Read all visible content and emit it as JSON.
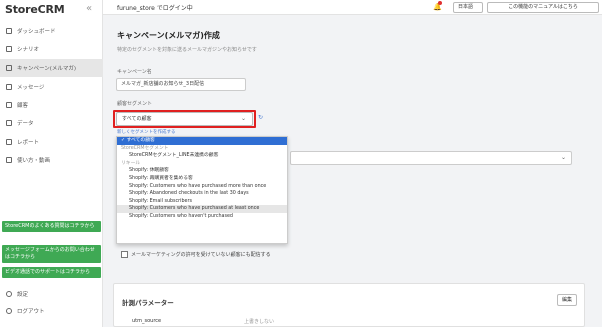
{
  "app": {
    "logo": "StoreCRM",
    "collapse": "«"
  },
  "sidebar": {
    "items": [
      {
        "label": "ダッシュボード"
      },
      {
        "label": "シナリオ"
      },
      {
        "label": "キャンペーン(メルマガ)"
      },
      {
        "label": "メッセージ"
      },
      {
        "label": "顧客"
      },
      {
        "label": "データ"
      },
      {
        "label": "レポート"
      },
      {
        "label": "使い方・動画"
      }
    ],
    "green_buttons": [
      {
        "label": "StoreCRMのよくある質問はコチラから"
      },
      {
        "label": "メッセージフォームからのお問い合わせはコチラから"
      },
      {
        "label": "ビデオ通話でのサポートはコチラから"
      }
    ],
    "bottom": [
      {
        "label": "設定"
      },
      {
        "label": "ログアウト"
      }
    ]
  },
  "topbar": {
    "store": "furune_store でログイン中",
    "bell": "🔔",
    "lang": "日本語",
    "manual": "この機能のマニュアルはこちら"
  },
  "page": {
    "title": "キャンペーン(メルマガ)作成",
    "subtitle": "特定のセグメントを対象に送るメールマガジンやお知らせです"
  },
  "form": {
    "name_label": "キャンペーン名",
    "name_value": "メルマガ_新店舗のお知らせ_3日配信",
    "segment_label": "顧客セグメント",
    "segment_value": "すべての顧客",
    "segment_link": "新しくセグメントを作成する",
    "refresh_icon": "refresh-icon"
  },
  "dropdown": {
    "options": [
      {
        "label": "✓ すべての顧客",
        "kind": "selected"
      },
      {
        "label": "StoreCRMセグメント",
        "kind": "group"
      },
      {
        "label": "StoreCRMセグメント_LINE未連携の顧客",
        "kind": "item"
      },
      {
        "label": "リキール",
        "kind": "group"
      },
      {
        "label": "Shopify: 休眠顧客",
        "kind": "item"
      },
      {
        "label": "Shopify: 再購買者を集める客",
        "kind": "item"
      },
      {
        "label": "Shopify: Customers who have purchased more than once",
        "kind": "item"
      },
      {
        "label": "Shopify: Abandoned checkouts in the last 30 days",
        "kind": "item"
      },
      {
        "label": "Shopify: Email subscribers",
        "kind": "item"
      },
      {
        "label": "Shopify: Customers who have purchased at least once",
        "kind": "hover"
      },
      {
        "label": "Shopify: Customers who haven't purchased",
        "kind": "item"
      }
    ]
  },
  "checkbox": {
    "label": "メールマーケティングの許可を受けていない顧客にも配信する"
  },
  "params": {
    "title": "計測パラメーター",
    "edit": "編集",
    "key": "utm_source",
    "value": "上書きしない"
  }
}
